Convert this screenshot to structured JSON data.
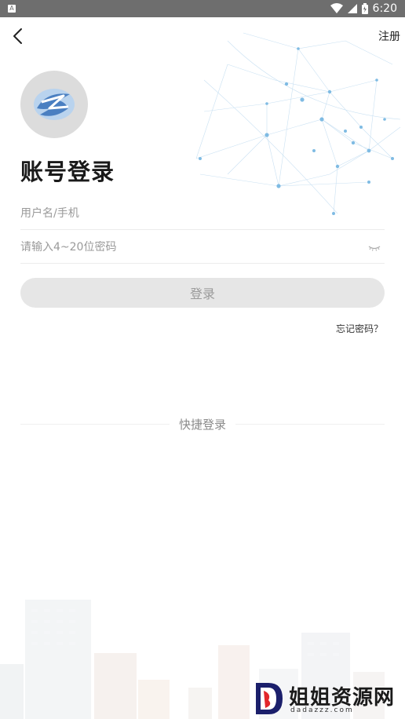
{
  "status_bar": {
    "time": "6:20",
    "icons": [
      "app-notification-icon",
      "wifi-icon",
      "cell-signal-icon",
      "battery-icon"
    ]
  },
  "header": {
    "register_label": "注册"
  },
  "title": "账号登录",
  "form": {
    "username_placeholder": "用户名/手机",
    "password_placeholder": "请输入4~20位密码",
    "login_label": "登录",
    "forgot_label": "忘记密码？"
  },
  "quick_login": {
    "label": "快捷登录"
  },
  "watermark": {
    "text": "姐姐资源网",
    "url": "dadazzz.com"
  },
  "colors": {
    "status_bar": "#6e6e6e",
    "button_bg": "#e6e6e6",
    "button_text": "#9a9a9a",
    "logo_bg": "#dcdcdc",
    "logo_accent": "#4a7fc1"
  }
}
